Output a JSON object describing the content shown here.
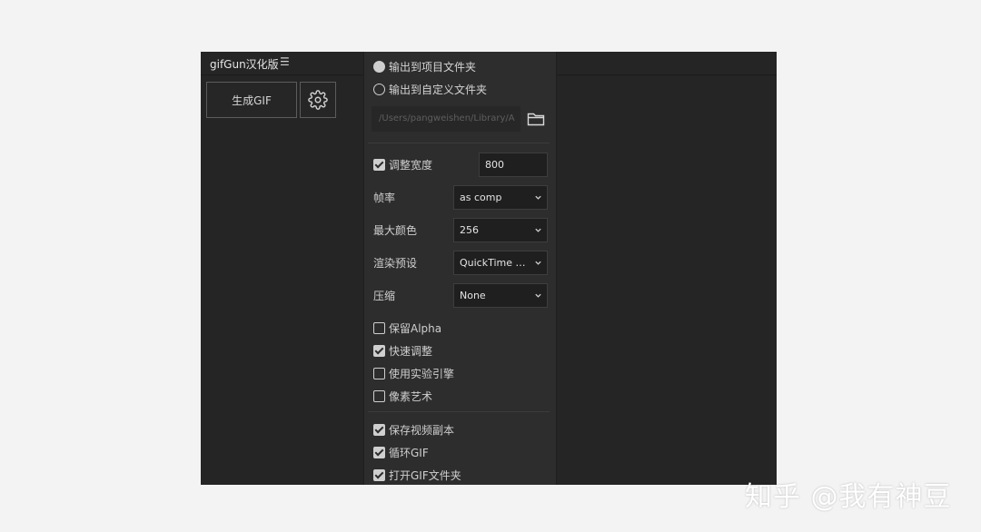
{
  "panel": {
    "title": "gifGun汉化版",
    "menu_icon": "hamburger-icon",
    "generate_label": "生成GIF",
    "settings_icon": "gear-icon"
  },
  "popup": {
    "output_options": [
      {
        "label": "输出到项目文件夹",
        "selected": true
      },
      {
        "label": "输出到自定义文件夹",
        "selected": false
      }
    ],
    "path_value": "/Users/pangweishen/Library/A",
    "folder_icon": "folder-icon",
    "resize": {
      "label": "调整宽度",
      "checked": true,
      "value": "800"
    },
    "fps": {
      "label": "帧率",
      "value": "as comp"
    },
    "max_colors": {
      "label": "最大颜色",
      "value": "256"
    },
    "render_preset": {
      "label": "渲染预设",
      "value": "QuickTime DV..."
    },
    "compression": {
      "label": "压缩",
      "value": "None"
    },
    "checkboxes_group1": [
      {
        "label": "保留Alpha",
        "checked": false
      },
      {
        "label": "快速调整",
        "checked": true
      },
      {
        "label": "使用实验引擎",
        "checked": false
      },
      {
        "label": "像素艺术",
        "checked": false
      }
    ],
    "checkboxes_group2": [
      {
        "label": "保存视频副本",
        "checked": true
      },
      {
        "label": "循环GIF",
        "checked": true
      },
      {
        "label": "打开GIF文件夹",
        "checked": true
      }
    ]
  },
  "watermark": "知乎 @我有神豆",
  "colors": {
    "background": "#f3f3f3",
    "panel": "#252525",
    "popup": "#2d2d2d",
    "field": "#1f1f1f"
  }
}
